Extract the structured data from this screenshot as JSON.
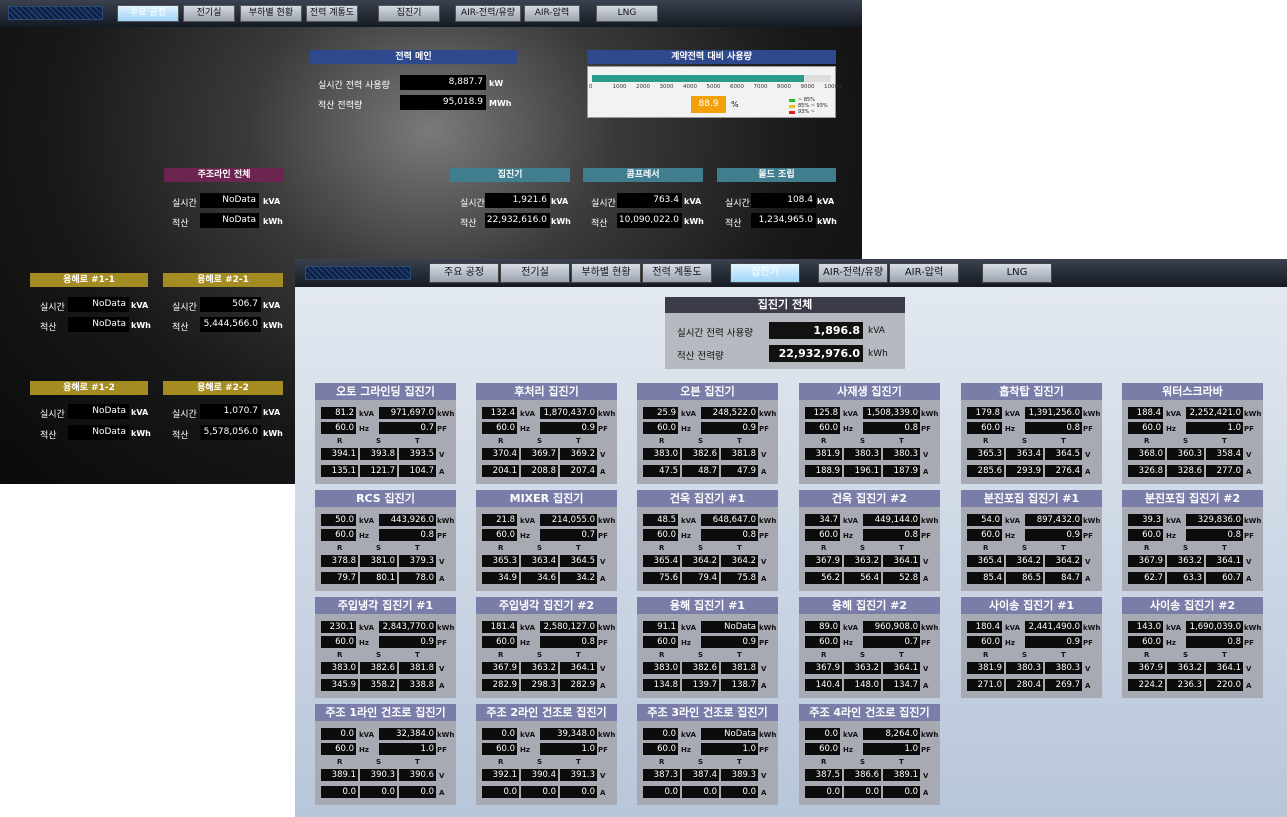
{
  "window1": {
    "tabs": [
      "주요 공정",
      "전기실",
      "부하별 현황",
      "전력 계통도",
      "집진기",
      "AIR-전력/유량",
      "AIR-압력",
      "LNG"
    ],
    "power_main": {
      "title": "전력 메인",
      "realtime_label": "실시간 전력 사용량",
      "realtime_value": "8,887.7",
      "realtime_unit": "kW",
      "cumulative_label": "적산 전력량",
      "cumulative_value": "95,018.9",
      "cumulative_unit": "MWh"
    },
    "contract": {
      "title": "계약전력 대비 사용량",
      "progress": 0.889,
      "ticks": [
        "0",
        "1000",
        "2000",
        "3000",
        "4000",
        "5000",
        "6000",
        "7000",
        "8000",
        "9000",
        "10000"
      ],
      "percent": "88.9",
      "percent_unit": "%",
      "legend": [
        "~ 85%",
        "85% ~ 93%",
        "93% ~"
      ],
      "legend_colors": [
        "#22c22e",
        "#e8c020",
        "#e02020"
      ]
    },
    "realtime_label": "실시간",
    "cumulative_label": "적산",
    "panels": [
      {
        "title": "주조라인 전체",
        "rt": "NoData",
        "rt_unit": "kVA",
        "cum": "NoData",
        "cum_unit": "kWh"
      },
      {
        "title": "집진기",
        "rt": "1,921.6",
        "rt_unit": "kVA",
        "cum": "22,932,616.0",
        "cum_unit": "kWh"
      },
      {
        "title": "콤프레서",
        "rt": "763.4",
        "rt_unit": "kVA",
        "cum": "10,090,022.0",
        "cum_unit": "kWh"
      },
      {
        "title": "몰드 조립",
        "rt": "108.4",
        "rt_unit": "kVA",
        "cum": "1,234,965.0",
        "cum_unit": "kWh"
      },
      {
        "title": "용해로 #1-1",
        "rt": "NoData",
        "rt_unit": "kVA",
        "cum": "NoData",
        "cum_unit": "kWh"
      },
      {
        "title": "용해로 #2-1",
        "rt": "506.7",
        "rt_unit": "kVA",
        "cum": "5,444,566.0",
        "cum_unit": "kWh"
      },
      {
        "title": "용해로 #1-2",
        "rt": "NoData",
        "rt_unit": "kVA",
        "cum": "NoData",
        "cum_unit": "kWh"
      },
      {
        "title": "용해로 #2-2",
        "rt": "1,070.7",
        "rt_unit": "kVA",
        "cum": "5,578,056.0",
        "cum_unit": "kWh"
      }
    ],
    "colors": {
      "accent": "#2e4a8c",
      "magenta": "#6b2550",
      "gold": "#a48b22",
      "teal": "#3f7d8f"
    }
  },
  "window2": {
    "tabs": [
      "주요 공정",
      "전기실",
      "부하별 현황",
      "전력 계통도",
      "집진기",
      "AIR-전력/유량",
      "AIR-압력",
      "LNG"
    ],
    "total": {
      "title": "집진기 전체",
      "realtime_label": "실시간 전력 사용량",
      "realtime_value": "1,896.8",
      "realtime_unit": "kVA",
      "cumulative_label": "적산 전력량",
      "cumulative_value": "22,932,976.0",
      "cumulative_unit": "kWh"
    },
    "units": {
      "kva": "kVA",
      "kwh": "kWh",
      "hz": "Hz",
      "pf": "PF",
      "v": "V",
      "a": "A",
      "r": "R",
      "s": "S",
      "t": "T"
    },
    "collectors": [
      {
        "name": "오토 그라인딩 집진기",
        "kva": "81.2",
        "kwh": "971,697.0",
        "hz": "60.0",
        "pf": "0.7",
        "v": [
          "394.1",
          "393.8",
          "393.5"
        ],
        "a": [
          "135.1",
          "121.7",
          "104.7"
        ]
      },
      {
        "name": "후처리 집진기",
        "kva": "132.4",
        "kwh": "1,870,437.0",
        "hz": "60.0",
        "pf": "0.9",
        "v": [
          "370.4",
          "369.7",
          "369.2"
        ],
        "a": [
          "204.1",
          "208.8",
          "207.4"
        ]
      },
      {
        "name": "오븐 집진기",
        "kva": "25.9",
        "kwh": "248,522.0",
        "hz": "60.0",
        "pf": "0.9",
        "v": [
          "383.0",
          "382.6",
          "381.8"
        ],
        "a": [
          "47.5",
          "48.7",
          "47.9"
        ]
      },
      {
        "name": "사재생 집진기",
        "kva": "125.8",
        "kwh": "1,508,339.0",
        "hz": "60.0",
        "pf": "0.8",
        "v": [
          "381.9",
          "380.3",
          "380.3"
        ],
        "a": [
          "188.9",
          "196.1",
          "187.9"
        ]
      },
      {
        "name": "흡착탑 집진기",
        "kva": "179.8",
        "kwh": "1,391,256.0",
        "hz": "60.0",
        "pf": "0.8",
        "v": [
          "365.3",
          "363.4",
          "364.5"
        ],
        "a": [
          "285.6",
          "293.9",
          "276.4"
        ]
      },
      {
        "name": "워터스크라바",
        "kva": "188.4",
        "kwh": "2,252,421.0",
        "hz": "60.0",
        "pf": "1.0",
        "v": [
          "368.0",
          "360.3",
          "358.4"
        ],
        "a": [
          "326.8",
          "328.6",
          "277.0"
        ]
      },
      {
        "name": "RCS 집진기",
        "kva": "50.0",
        "kwh": "443,926.0",
        "hz": "60.0",
        "pf": "0.8",
        "v": [
          "378.8",
          "381.0",
          "379.3"
        ],
        "a": [
          "79.7",
          "80.1",
          "78.0"
        ]
      },
      {
        "name": "MIXER 집진기",
        "kva": "21.8",
        "kwh": "214,055.0",
        "hz": "60.0",
        "pf": "0.7",
        "v": [
          "365.3",
          "363.4",
          "364.5"
        ],
        "a": [
          "34.9",
          "34.6",
          "34.2"
        ]
      },
      {
        "name": "건욱 집진기 #1",
        "kva": "48.5",
        "kwh": "648,647.0",
        "hz": "60.0",
        "pf": "0.8",
        "v": [
          "365.4",
          "364.2",
          "364.2"
        ],
        "a": [
          "75.6",
          "79.4",
          "75.8"
        ]
      },
      {
        "name": "건욱 집진기 #2",
        "kva": "34.7",
        "kwh": "449,144.0",
        "hz": "60.0",
        "pf": "0.8",
        "v": [
          "367.9",
          "363.2",
          "364.1"
        ],
        "a": [
          "56.2",
          "56.4",
          "52.8"
        ]
      },
      {
        "name": "분진포집 집진기 #1",
        "kva": "54.0",
        "kwh": "897,432.0",
        "hz": "60.0",
        "pf": "0.9",
        "v": [
          "365.4",
          "364.2",
          "364.2"
        ],
        "a": [
          "85.4",
          "86.5",
          "84.7"
        ]
      },
      {
        "name": "분진포집 집진기 #2",
        "kva": "39.3",
        "kwh": "329,836.0",
        "hz": "60.0",
        "pf": "0.8",
        "v": [
          "367.9",
          "363.2",
          "364.1"
        ],
        "a": [
          "62.7",
          "63.3",
          "60.7"
        ]
      },
      {
        "name": "주입냉각 집진기 #1",
        "kva": "230.1",
        "kwh": "2,843,770.0",
        "hz": "60.0",
        "pf": "0.9",
        "v": [
          "383.0",
          "382.6",
          "381.8"
        ],
        "a": [
          "345.9",
          "358.2",
          "338.8"
        ]
      },
      {
        "name": "주입냉각 집진기 #2",
        "kva": "181.4",
        "kwh": "2,580,127.0",
        "hz": "60.0",
        "pf": "0.8",
        "v": [
          "367.9",
          "363.2",
          "364.1"
        ],
        "a": [
          "282.9",
          "298.3",
          "282.9"
        ]
      },
      {
        "name": "용해 집진기 #1",
        "kva": "91.1",
        "kwh": "NoData",
        "hz": "60.0",
        "pf": "0.9",
        "v": [
          "383.0",
          "382.6",
          "381.8"
        ],
        "a": [
          "134.8",
          "139.7",
          "138.7"
        ]
      },
      {
        "name": "용해 집진기 #2",
        "kva": "89.0",
        "kwh": "960,908.0",
        "hz": "60.0",
        "pf": "0.7",
        "v": [
          "367.9",
          "363.2",
          "364.1"
        ],
        "a": [
          "140.4",
          "148.0",
          "134.7"
        ]
      },
      {
        "name": "사이송 집진기 #1",
        "kva": "180.4",
        "kwh": "2,441,490.0",
        "hz": "60.0",
        "pf": "0.9",
        "v": [
          "381.9",
          "380.3",
          "380.3"
        ],
        "a": [
          "271.0",
          "280.4",
          "269.7"
        ]
      },
      {
        "name": "사이송 집진기 #2",
        "kva": "143.0",
        "kwh": "1,690,039.0",
        "hz": "60.0",
        "pf": "0.8",
        "v": [
          "367.9",
          "363.2",
          "364.1"
        ],
        "a": [
          "224.2",
          "236.3",
          "220.0"
        ]
      },
      {
        "name": "주조 1라인 건조로 집진기",
        "kva": "0.0",
        "kwh": "32,384.0",
        "hz": "60.0",
        "pf": "1.0",
        "v": [
          "389.1",
          "390.3",
          "390.6"
        ],
        "a": [
          "0.0",
          "0.0",
          "0.0"
        ]
      },
      {
        "name": "주조 2라인 건조로 집진기",
        "kva": "0.0",
        "kwh": "39,348.0",
        "hz": "60.0",
        "pf": "1.0",
        "v": [
          "392.1",
          "390.4",
          "391.3"
        ],
        "a": [
          "0.0",
          "0.0",
          "0.0"
        ]
      },
      {
        "name": "주조 3라인 건조로 집진기",
        "kva": "0.0",
        "kwh": "NoData",
        "hz": "60.0",
        "pf": "1.0",
        "v": [
          "387.3",
          "387.4",
          "389.3"
        ],
        "a": [
          "0.0",
          "0.0",
          "0.0"
        ]
      },
      {
        "name": "주조 4라인 건조로 집진기",
        "kva": "0.0",
        "kwh": "8,264.0",
        "hz": "60.0",
        "pf": "1.0",
        "v": [
          "387.5",
          "386.6",
          "389.1"
        ],
        "a": [
          "0.0",
          "0.0",
          "0.0"
        ]
      }
    ]
  }
}
